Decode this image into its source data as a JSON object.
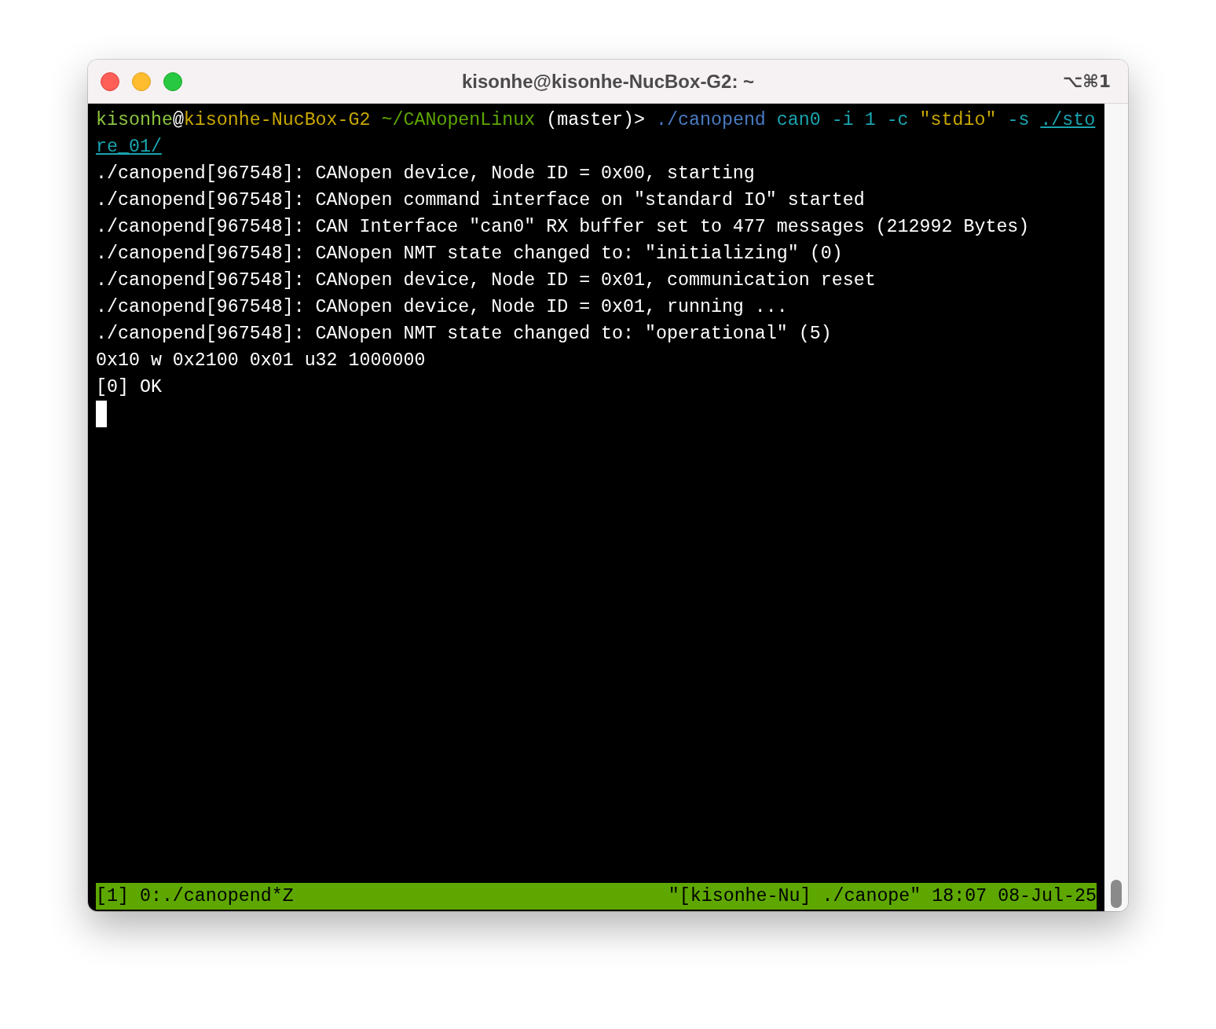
{
  "window": {
    "title": "kisonhe@kisonhe-NucBox-G2: ~",
    "shortcut": "⌥⌘1"
  },
  "terminal": {
    "prompt_segments": [
      {
        "kind": "user",
        "text": "kisonhe"
      },
      {
        "kind": "plain",
        "text": "@"
      },
      {
        "kind": "host",
        "text": "kisonhe-NucBox-G2"
      },
      {
        "kind": "cwd",
        "text": " ~/CANopenLinux"
      },
      {
        "kind": "plain",
        "text": " (master)> "
      },
      {
        "kind": "command",
        "text": "./canopend"
      },
      {
        "kind": "argument",
        "text": " can0 -i 1 -c "
      },
      {
        "kind": "string",
        "text": "\"stdio\""
      },
      {
        "kind": "argument",
        "text": " -s "
      },
      {
        "kind": "path",
        "text": "./store_01/"
      }
    ],
    "output_lines": [
      "./canopend[967548]: CANopen device, Node ID = 0x00, starting",
      "./canopend[967548]: CANopen command interface on \"standard IO\" started",
      "./canopend[967548]: CAN Interface \"can0\" RX buffer set to 477 messages (212992 Bytes)",
      "./canopend[967548]: CANopen NMT state changed to: \"initializing\" (0)",
      "./canopend[967548]: CANopen device, Node ID = 0x01, communication reset",
      "./canopend[967548]: CANopen device, Node ID = 0x01, running ...",
      "./canopend[967548]: CANopen NMT state changed to: \"operational\" (5)",
      "0x10 w 0x2100 0x01 u32 1000000",
      "[0] OK"
    ],
    "cursor_visible": true
  },
  "status_bar": {
    "left": "[1] 0:./canopend*Z",
    "right": "\"[kisonhe-Nu] ./canope\" 18:07 08-Jul-25"
  }
}
